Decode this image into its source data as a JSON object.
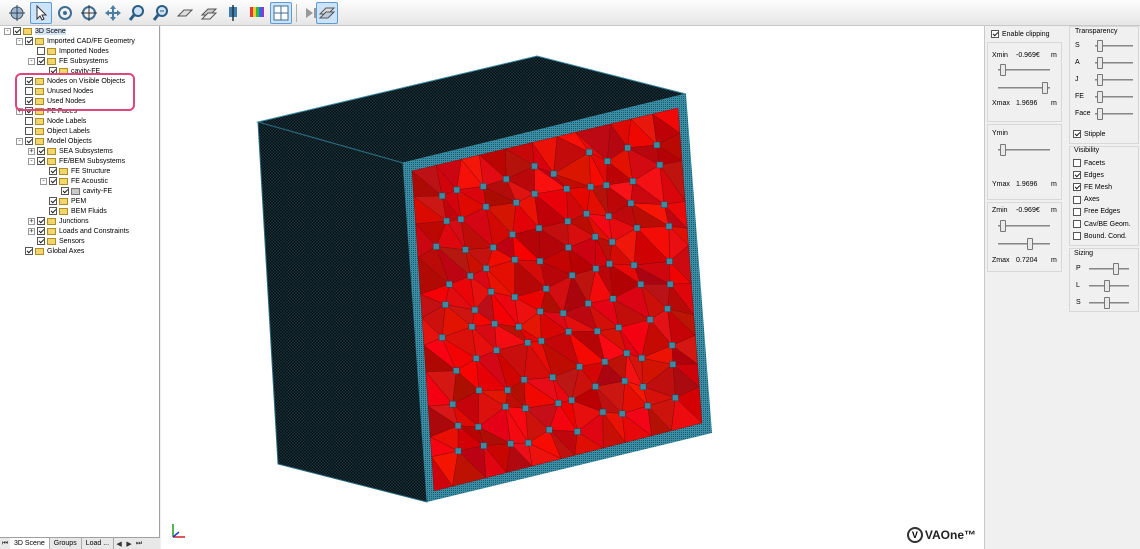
{
  "toolbar": {
    "buttons": [
      {
        "icon": "globe-icon"
      },
      {
        "icon": "pointer-icon"
      },
      {
        "icon": "rotate-icon"
      },
      {
        "icon": "rotate-axis-icon"
      },
      {
        "icon": "pan-icon"
      },
      {
        "icon": "zoom-icon"
      },
      {
        "icon": "zoom-window-icon"
      },
      {
        "icon": "plane-icon"
      },
      {
        "icon": "section-icon"
      },
      {
        "icon": "move-icon"
      },
      {
        "icon": "color-palette-icon"
      },
      {
        "icon": "split-view-icon"
      },
      {
        "icon": "play-step-icon"
      },
      {
        "icon": "slice-view-icon"
      }
    ]
  },
  "tree": {
    "items": [
      {
        "label": "3D Scene",
        "level": 0,
        "expander": "-",
        "checked": true,
        "selected": true
      },
      {
        "label": "Imported CAD/FE Geometry",
        "level": 1,
        "expander": "-",
        "checked": true
      },
      {
        "label": "Imported Nodes",
        "level": 2,
        "expander": "",
        "checked": false
      },
      {
        "label": "FE Subsystems",
        "level": 2,
        "expander": "-",
        "checked": true
      },
      {
        "label": "cavity-FE",
        "level": 3,
        "expander": "",
        "checked": true
      },
      {
        "label": "Nodes on Visible Objects",
        "level": 1,
        "expander": "",
        "checked": true
      },
      {
        "label": "Unused Nodes",
        "level": 1,
        "expander": "",
        "checked": false
      },
      {
        "label": "Used Nodes",
        "level": 1,
        "expander": "",
        "checked": true
      },
      {
        "label": "FE Faces",
        "level": 1,
        "expander": "+",
        "checked": true
      },
      {
        "label": "Node Labels",
        "level": 1,
        "expander": "",
        "checked": false
      },
      {
        "label": "Object Labels",
        "level": 1,
        "expander": "",
        "checked": false
      },
      {
        "label": "Model Objects",
        "level": 1,
        "expander": "-",
        "checked": true
      },
      {
        "label": "SEA Subsystems",
        "level": 2,
        "expander": "+",
        "checked": true
      },
      {
        "label": "FE/BEM Subsystems",
        "level": 2,
        "expander": "-",
        "checked": true
      },
      {
        "label": "FE Structure",
        "level": 3,
        "expander": "",
        "checked": true
      },
      {
        "label": "FE Acoustic",
        "level": 3,
        "expander": "-",
        "checked": true
      },
      {
        "label": "cavity-FE",
        "level": 4,
        "expander": "",
        "checked": true,
        "mesh": true
      },
      {
        "label": "PEM",
        "level": 3,
        "expander": "",
        "checked": true
      },
      {
        "label": "BEM Fluids",
        "level": 3,
        "expander": "",
        "checked": true
      },
      {
        "label": "Junctions",
        "level": 2,
        "expander": "+",
        "checked": true
      },
      {
        "label": "Loads and Constraints",
        "level": 2,
        "expander": "+",
        "checked": true
      },
      {
        "label": "Sensors",
        "level": 2,
        "expander": "",
        "checked": true
      },
      {
        "label": "Global Axes",
        "level": 1,
        "expander": "",
        "checked": true
      }
    ],
    "tabs": [
      "3D Scene",
      "Groups",
      "Load ..."
    ],
    "nav_glyphs": [
      "⏮",
      "◀",
      "▶",
      "⏭"
    ]
  },
  "viewport": {
    "logo_glyph": "V",
    "logo_text": "VAOne™",
    "mesh_color": "#e8191b",
    "box_color": "#0a1418",
    "edge_color": "#3a8ea6"
  },
  "clipping": {
    "enable_label": "Enable clipping",
    "enabled": true,
    "unit": "m",
    "x": {
      "min_label": "Xmin",
      "min_value": "-0.969€",
      "max_label": "Xmax",
      "max_value": "1.9696",
      "min_slider": 0.05,
      "max_slider": 0.95
    },
    "y": {
      "min_label": "Ymin",
      "min_value": "",
      "max_label": "Ymax",
      "max_value": "1.9696",
      "min_slider": 0.05,
      "max_slider": 0.95
    },
    "z": {
      "min_label": "Zmin",
      "min_value": "-0.969€",
      "max_label": "Zmax",
      "max_value": "0.7204",
      "min_slider": 0.05,
      "max_slider": 0.62
    }
  },
  "transparency": {
    "title": "Transparency",
    "sliders": [
      {
        "label": "S",
        "level": 0.05
      },
      {
        "label": "A",
        "level": 0.05
      },
      {
        "label": "J",
        "level": 0.05
      },
      {
        "label": "FE",
        "level": 0.05
      },
      {
        "label": "Face",
        "level": 0.05
      }
    ],
    "stipple_label": "Stipple",
    "stipple_checked": true
  },
  "visibility": {
    "title": "Visibility",
    "options": [
      {
        "label": "Facets",
        "checked": false
      },
      {
        "label": "Edges",
        "checked": true
      },
      {
        "label": "FE Mesh",
        "checked": true
      },
      {
        "label": "Axes",
        "checked": false
      },
      {
        "label": "Free Edges",
        "checked": false
      },
      {
        "label": "Cav/BE Geom.",
        "checked": false
      },
      {
        "label": "Bound. Cond.",
        "checked": false
      }
    ]
  },
  "sizing": {
    "title": "Sizing",
    "sliders": [
      {
        "label": "P",
        "level": 0.7
      },
      {
        "label": "L",
        "level": 0.45
      },
      {
        "label": "S",
        "level": 0.45
      }
    ]
  }
}
